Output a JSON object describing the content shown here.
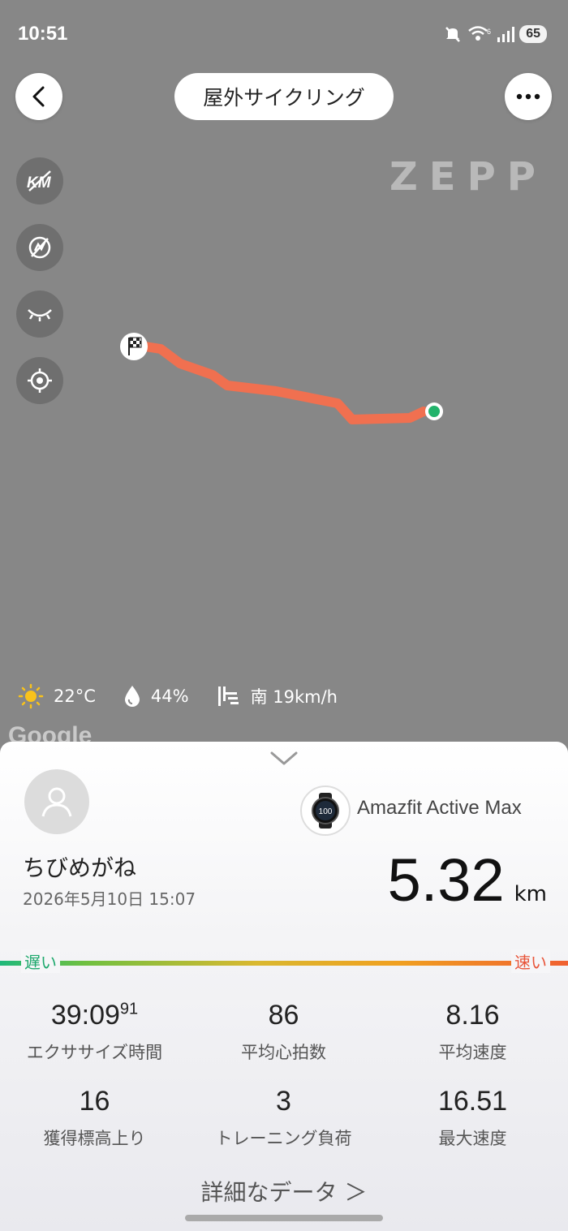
{
  "status_bar": {
    "time": "10:51",
    "battery": "65",
    "network_badge": "6"
  },
  "header": {
    "title": "屋外サイクリング"
  },
  "map": {
    "watermark": "ZEPP",
    "google_logo": "Google",
    "route_color": "#f07050",
    "tools": [
      "km-marker-icon",
      "no-pace-icon",
      "eye-icon",
      "locate-icon"
    ]
  },
  "weather": {
    "temperature": "22°C",
    "humidity": "44%",
    "wind": "南 19km/h"
  },
  "summary": {
    "username": "ちびめがね",
    "datetime": "2026年5月10日 15:07",
    "device": "Amazfit Active Max",
    "distance_value": "5.32",
    "distance_unit": "km"
  },
  "speed_scale": {
    "slow": "遅い",
    "fast": "速い"
  },
  "stats": [
    {
      "value": "39:09",
      "sup": "91",
      "label": "エクササイズ時間"
    },
    {
      "value": "86",
      "label": "平均心拍数"
    },
    {
      "value": "8.16",
      "label": "平均速度"
    },
    {
      "value": "16",
      "label": "獲得標高上り"
    },
    {
      "value": "3",
      "label": "トレーニング負荷"
    },
    {
      "value": "16.51",
      "label": "最大速度"
    }
  ],
  "detail_link": "詳細なデータ ＞"
}
